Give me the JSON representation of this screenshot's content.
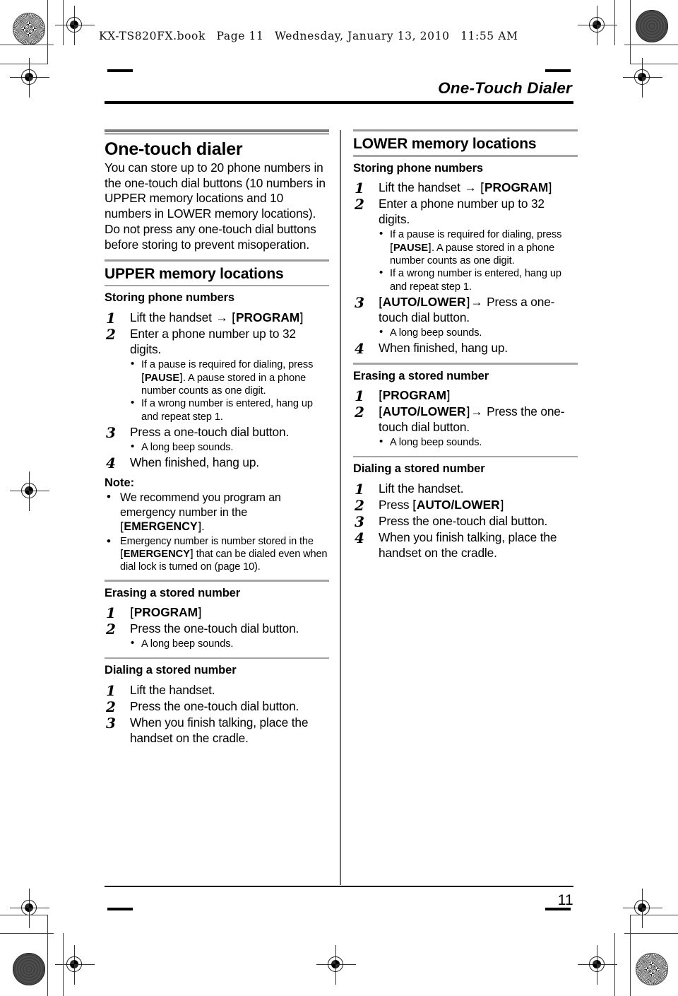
{
  "print_header": {
    "file": "KX-TS820FX.book",
    "page_label": "Page 11",
    "date": "Wednesday, January 13, 2010",
    "time": "11:55 AM"
  },
  "running_head": {
    "title": "One-Touch Dialer"
  },
  "footer": {
    "page_number": "11"
  },
  "left_column": {
    "main_heading": "One-touch dialer",
    "intro": "You can store up to 20 phone numbers in the one-touch dial buttons (10 numbers in UPPER memory locations and 10 numbers in LOWER memory locations). Do not press any one-touch dial buttons before storing to prevent misoperation.",
    "section_heading": "UPPER memory locations",
    "storing": {
      "heading": "Storing phone numbers",
      "steps": [
        {
          "num": "1",
          "text_before": "Lift the handset ",
          "arrow": "→",
          "key": "PROGRAM",
          "text_after": ""
        },
        {
          "num": "2",
          "text": "Enter a phone number up to 32 digits."
        },
        {
          "num": "3",
          "text": "Press a one-touch dial button."
        },
        {
          "num": "4",
          "text": "When finished, hang up."
        }
      ],
      "step2_bullets": [
        {
          "pre": "If a pause is required for dialing, press ",
          "key": "PAUSE",
          "post": ". A pause stored in a phone number counts as one digit."
        },
        {
          "pre": "If a wrong number is entered, hang up and repeat step 1.",
          "key": "",
          "post": ""
        }
      ],
      "step3_bullet": "A long beep sounds."
    },
    "note": {
      "label": "Note:",
      "bullet1_pre": "We recommend you program an emergency number in the ",
      "bullet1_key": "EMERGENCY",
      "bullet1_post": ".",
      "bullet2_pre": "Emergency number is number stored in the ",
      "bullet2_key": "EMERGENCY",
      "bullet2_post": " that can be dialed even when dial lock is turned on (page 10)."
    },
    "erasing": {
      "heading": "Erasing a stored number",
      "step1_num": "1",
      "step1_key": "PROGRAM",
      "step2_num": "2",
      "step2_text": "Press the one-touch dial button.",
      "step2_bullet": "A long beep sounds."
    },
    "dialing": {
      "heading": "Dialing a stored number",
      "steps": [
        {
          "num": "1",
          "text": "Lift the handset."
        },
        {
          "num": "2",
          "text": "Press the one-touch dial button."
        },
        {
          "num": "3",
          "text": "When you finish talking, place the handset on the cradle."
        }
      ]
    }
  },
  "right_column": {
    "section_heading": "LOWER memory locations",
    "storing": {
      "heading": "Storing phone numbers",
      "step1_num": "1",
      "step1_pre": "Lift the handset ",
      "step1_arrow": "→",
      "step1_key": "PROGRAM",
      "step2_num": "2",
      "step2_text": "Enter a phone number up to 32 digits.",
      "step2_bullets": [
        {
          "pre": "If a pause is required for dialing, press ",
          "key": "PAUSE",
          "post": ". A pause stored in a phone number counts as one digit."
        },
        {
          "pre": "If a wrong number is entered, hang up and repeat step 1.",
          "key": "",
          "post": ""
        }
      ],
      "step3_num": "3",
      "step3_key": "AUTO/LOWER",
      "step3_arrow": "→",
      "step3_post": " Press a one-touch dial button.",
      "step3_bullet": "A long beep sounds.",
      "step4_num": "4",
      "step4_text": "When finished, hang up."
    },
    "erasing": {
      "heading": "Erasing a stored number",
      "step1_num": "1",
      "step1_key": "PROGRAM",
      "step2_num": "2",
      "step2_key": "AUTO/LOWER",
      "step2_arrow": "→",
      "step2_post": " Press the one-touch dial button.",
      "step2_bullet": "A long beep sounds."
    },
    "dialing": {
      "heading": "Dialing a stored number",
      "step1_num": "1",
      "step1_text": "Lift the handset.",
      "step2_num": "2",
      "step2_pre": "Press ",
      "step2_key": "AUTO/LOWER",
      "step3_num": "3",
      "step3_text": "Press the one-touch dial button.",
      "step4_num": "4",
      "step4_text": "When you finish talking, place the handset on the cradle."
    }
  }
}
